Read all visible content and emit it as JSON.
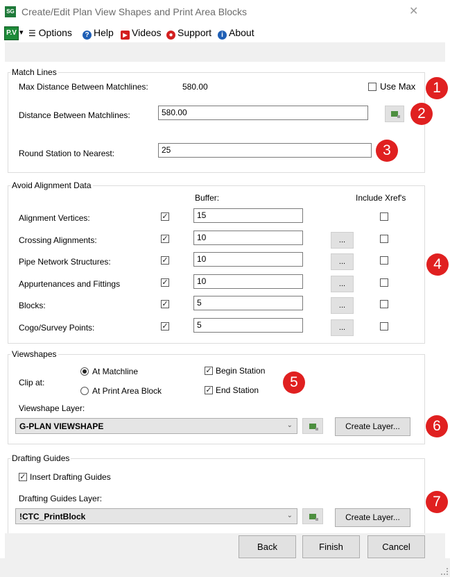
{
  "window": {
    "title": "Create/Edit Plan View Shapes and Print Area Blocks",
    "close_glyph": "✕"
  },
  "menubar": {
    "logo": "P.V",
    "logo_caret": "▾",
    "options": "Options",
    "help": "Help",
    "videos": "Videos",
    "support": "Support",
    "about": "About"
  },
  "match_lines": {
    "legend": "Match Lines",
    "max_distance_label": "Max Distance Between Matchlines:",
    "max_distance_value": "580.00",
    "use_max_label": "Use Max",
    "use_max_checked": false,
    "distance_label": "Distance Between Matchlines:",
    "distance_value": "580.00",
    "round_label": "Round Station to Nearest:",
    "round_value": "25"
  },
  "avoid": {
    "legend": "Avoid Alignment Data",
    "buffer_header": "Buffer:",
    "xref_header": "Include Xref's",
    "browse_label": "...",
    "rows": [
      {
        "label": "Alignment Vertices:",
        "checked": true,
        "buffer": "15",
        "has_browse": false,
        "xref": false
      },
      {
        "label": "Crossing Alignments:",
        "checked": true,
        "buffer": "10",
        "has_browse": true,
        "xref": false
      },
      {
        "label": "Pipe Network Structures:",
        "checked": true,
        "buffer": "10",
        "has_browse": true,
        "xref": false
      },
      {
        "label": "Appurtenances and Fittings",
        "checked": true,
        "buffer": "10",
        "has_browse": true,
        "xref": false
      },
      {
        "label": "Blocks:",
        "checked": true,
        "buffer": "5",
        "has_browse": true,
        "xref": false
      },
      {
        "label": "Cogo/Survey Points:",
        "checked": true,
        "buffer": "5",
        "has_browse": true,
        "xref": false
      }
    ]
  },
  "viewshapes": {
    "legend": "Viewshapes",
    "clip_label": "Clip at:",
    "opt_matchline": "At Matchline",
    "opt_print_area": "At Print Area Block",
    "begin_station": "Begin Station",
    "end_station": "End Station",
    "layer_label": "Viewshape Layer:",
    "layer_value": "G-PLAN VIEWSHAPE",
    "create_layer": "Create Layer..."
  },
  "drafting": {
    "legend": "Drafting Guides",
    "insert_label": "Insert Drafting Guides",
    "layer_label": "Drafting Guides Layer:",
    "layer_value": "!CTC_PrintBlock",
    "create_layer": "Create Layer..."
  },
  "footer": {
    "back": "Back",
    "finish": "Finish",
    "cancel": "Cancel"
  },
  "markers": [
    "1",
    "2",
    "3",
    "4",
    "5",
    "6",
    "7"
  ],
  "colors": {
    "marker": "#e02020",
    "logo_green": "#1e8b39",
    "help_blue": "#1f5fb5",
    "videos_red": "#d32020"
  },
  "icons": {
    "check_glyph": "✓",
    "chevron_glyph": "⌄",
    "menu_icon": "☰"
  }
}
